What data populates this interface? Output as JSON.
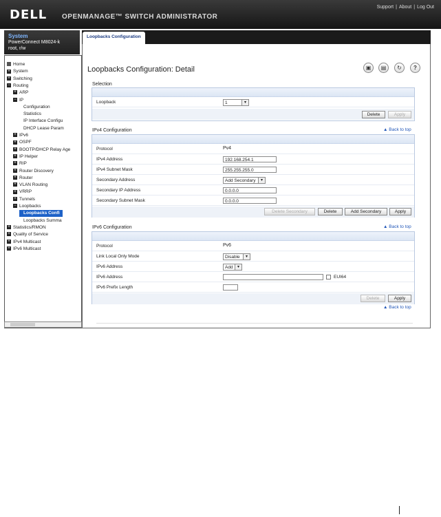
{
  "header": {
    "logo": "DELL",
    "product": "OPENMANAGE™ SWITCH ADMINISTRATOR",
    "links": [
      "Support",
      "About",
      "Log Out"
    ]
  },
  "system": {
    "title": "System",
    "model": "PowerConnect M8024-k",
    "access": "root, r/w"
  },
  "nav": [
    {
      "label": "Home",
      "toggle": "",
      "icon": "home"
    },
    {
      "label": "System",
      "toggle": "+"
    },
    {
      "label": "Switching",
      "toggle": "+"
    },
    {
      "label": "Routing",
      "toggle": "−"
    },
    {
      "label": "ARP",
      "toggle": "+"
    },
    {
      "label": "IP",
      "toggle": "−"
    },
    {
      "label": "Configuration",
      "toggle": ""
    },
    {
      "label": "Statistics",
      "toggle": ""
    },
    {
      "label": "IP Interface Configu",
      "toggle": ""
    },
    {
      "label": "DHCP Lease Param",
      "toggle": ""
    },
    {
      "label": "IPv6",
      "toggle": "+"
    },
    {
      "label": "OSPF",
      "toggle": "+"
    },
    {
      "label": "BOOTP/DHCP Relay Age",
      "toggle": "+"
    },
    {
      "label": "IP Helper",
      "toggle": "+"
    },
    {
      "label": "RIP",
      "toggle": "+"
    },
    {
      "label": "Router Discovery",
      "toggle": "+"
    },
    {
      "label": "Router",
      "toggle": "+"
    },
    {
      "label": "VLAN Routing",
      "toggle": "+"
    },
    {
      "label": "VRRP",
      "toggle": "+"
    },
    {
      "label": "Tunnels",
      "toggle": "+"
    },
    {
      "label": "Loopbacks",
      "toggle": "−"
    },
    {
      "label": "Loopbacks Confi",
      "toggle": ""
    },
    {
      "label": "Loopbacks Summa",
      "toggle": ""
    },
    {
      "label": "Statistics/RMON",
      "toggle": "+"
    },
    {
      "label": "Quality of Service",
      "toggle": "+"
    },
    {
      "label": "IPv4 Multicast",
      "toggle": "+"
    },
    {
      "label": "IPv6 Multicast",
      "toggle": "+"
    }
  ],
  "tab": "Loopbacks Configuration",
  "page_title": "Loopbacks Configuration: Detail",
  "icons": [
    "save-icon",
    "print-icon",
    "refresh-icon",
    "help-icon"
  ],
  "back_to_top": "▲ Back to top",
  "selection": {
    "heading": "Selection",
    "loopback_label": "Loopback",
    "loopback_value": "1",
    "delete": "Delete",
    "apply": "Apply"
  },
  "ipv4": {
    "heading": "IPv4 Configuration",
    "protocol_label": "Protocol",
    "protocol_value": "Pv4",
    "address_label": "IPv4 Address",
    "address_value": "192.168.254.1",
    "mask_label": "IPv4 Subnet Mask",
    "mask_value": "255.255.255.0",
    "secondary_label": "Secondary Address",
    "secondary_value": "Add Secondary",
    "sec_ip_label": "Secondary IP Address",
    "sec_ip_value": "0.0.0.0",
    "sec_mask_label": "Secondary Subnet Mask",
    "sec_mask_value": "0.0.0.0",
    "delete_secondary": "Delete Secondary",
    "delete": "Delete",
    "add_secondary": "Add Secondary",
    "apply": "Apply"
  },
  "ipv6": {
    "heading": "IPv6 Configuration",
    "protocol_label": "Protocol",
    "protocol_value": "Pv6",
    "link_local_label": "Link Local Only Mode",
    "link_local_value": "Disable",
    "addr_mode_label": "IPv6 Address",
    "addr_mode_value": "Add",
    "address_label": "IPv6 Address",
    "address_value": "",
    "eui64": "EUI64",
    "prefix_label": "IPv6 Prefix Length",
    "prefix_value": "",
    "delete": "Delete",
    "apply": "Apply"
  }
}
